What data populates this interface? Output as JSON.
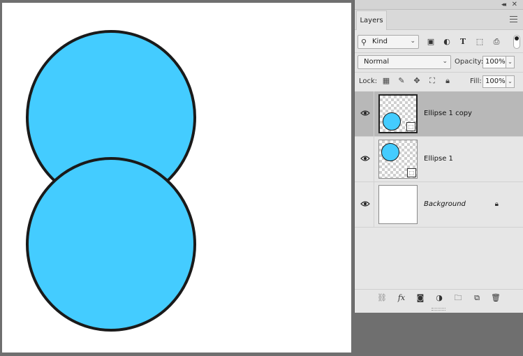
{
  "canvas": {
    "shape_fill": "#44ccff",
    "shape_stroke": "#1a1a1a",
    "shapes": [
      "Ellipse 1",
      "Ellipse 1 copy"
    ]
  },
  "panel": {
    "tab_label": "Layers",
    "filter": {
      "kind_label": "Kind",
      "icons": [
        "image-filter-icon",
        "adjustment-filter-icon",
        "type-filter-icon",
        "shape-filter-icon",
        "smart-object-filter-icon"
      ]
    },
    "blend_mode": "Normal",
    "opacity_label": "Opacity:",
    "opacity_value": "100%",
    "lock_label": "Lock:",
    "fill_label": "Fill:",
    "fill_value": "100%",
    "layers": [
      {
        "name": "Ellipse 1 copy",
        "selected": true,
        "visible": true
      },
      {
        "name": "Ellipse 1",
        "selected": false,
        "visible": true
      },
      {
        "name": "Background",
        "selected": false,
        "visible": true,
        "locked": true
      }
    ]
  }
}
